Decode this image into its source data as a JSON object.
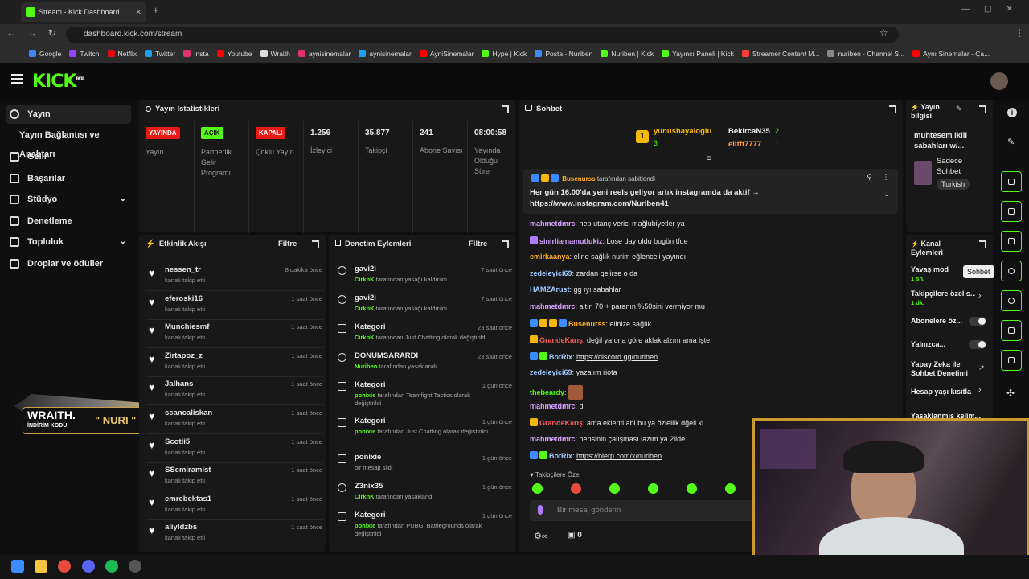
{
  "browser": {
    "tab_title": "Stream - Kick Dashboard",
    "url": "dashboard.kick.com/stream",
    "bookmarks": [
      "Google",
      "Twitch",
      "Netflix",
      "Twitter",
      "Insta",
      "Youtube",
      "Wraith",
      "aynisinemalar",
      "aynisinemalar",
      "AyniSinemalar",
      "Hype | Kick",
      "Posta - Nuriben",
      "Nuriben | Kick",
      "Yayıncı Paneli | Kick",
      "Streamer Content M...",
      "nuriben - Channel S...",
      "Aynı Sinemalar - Ça..."
    ]
  },
  "header": {
    "logo": "KICK",
    "logo_tag": "BETA"
  },
  "sidebar": {
    "items": [
      {
        "label": "Yayın",
        "active": true
      },
      {
        "label": "Yayın Bağlantısı ve Anahtarı"
      },
      {
        "label": "Gelir"
      },
      {
        "label": "Başarılar"
      },
      {
        "label": "Stüdyo"
      },
      {
        "label": "Denetleme"
      },
      {
        "label": "Topluluk"
      },
      {
        "label": "Droplar ve ödüller"
      }
    ]
  },
  "promo": {
    "brand": "WRAITH.",
    "code_label": "İNDİRİM KODU:",
    "code": "\" NURI \""
  },
  "stats": {
    "title": "Yayın İstatistikleri",
    "items": [
      {
        "badge": "YAYINDA",
        "label": "Yayın",
        "color": "#e91916"
      },
      {
        "badge": "AÇIK",
        "label": "Partnerlik Gelir Programı",
        "color": "#53fc18"
      },
      {
        "badge": "KAPALI",
        "label": "Çoklu Yayın",
        "color": "#e91916"
      },
      {
        "value": "1.256",
        "label": "İzleyici"
      },
      {
        "value": "35.877",
        "label": "Takipçi"
      },
      {
        "value": "241",
        "label": "Abone Sayısı"
      },
      {
        "value": "08:00:58",
        "label": "Yayında Olduğu Süre"
      }
    ]
  },
  "activity": {
    "title": "Etkinlik Akışı",
    "filter": "Filtre",
    "items": [
      {
        "name": "nessen_tr",
        "action": "kanalı takip etti",
        "time": "8 dakika önce"
      },
      {
        "name": "eferoski16",
        "action": "kanalı takip etti",
        "time": "1 saat önce"
      },
      {
        "name": "Munchiesmf",
        "action": "kanalı takip etti",
        "time": "1 saat önce"
      },
      {
        "name": "Zirtapoz_z",
        "action": "kanalı takip etti",
        "time": "1 saat önce"
      },
      {
        "name": "Jalhans",
        "action": "kanalı takip etti",
        "time": "1 saat önce"
      },
      {
        "name": "scancaliskan",
        "action": "kanalı takip etti",
        "time": "1 saat önce"
      },
      {
        "name": "Scotii5",
        "action": "kanalı takip etti",
        "time": "1 saat önce"
      },
      {
        "name": "SSemiramist",
        "action": "kanalı takip etti",
        "time": "1 saat önce"
      },
      {
        "name": "emrebektas1",
        "action": "kanalı takip etti",
        "time": "1 saat önce"
      },
      {
        "name": "aliyldzbs",
        "action": "kanalı takip etti",
        "time": "1 saat önce"
      }
    ]
  },
  "moderation": {
    "title": "Denetim Eylemleri",
    "filter": "Filtre",
    "items": [
      {
        "name": "gavi2i",
        "actor": "CirknK",
        "text": "tarafından yasağı kaldırıldı",
        "time": "7 saat önce"
      },
      {
        "name": "gavi2i",
        "actor": "CirknK",
        "text": "tarafından yasağı kaldırıldı",
        "time": "7 saat önce"
      },
      {
        "name": "Kategori",
        "actor": "CirknK",
        "text": "tarafından Just Chatting olarak değiştirildi",
        "time": "23 saat önce"
      },
      {
        "name": "DONUMSARARDI",
        "actor": "Nuriben",
        "text": "tarafından yasaklandı",
        "time": "23 saat önce"
      },
      {
        "name": "Kategori",
        "actor": "ponixie",
        "text": "tarafından Teamfight Tactics olarak değiştirildi",
        "time": "1 gün önce"
      },
      {
        "name": "Kategori",
        "actor": "ponixie",
        "text": "tarafından Just Chatting olarak değiştirildi",
        "time": "1 gün önce"
      },
      {
        "name": "ponixie",
        "actor": "",
        "text": "bir mesajı sildi",
        "time": "1 gün önce"
      },
      {
        "name": "Z3nix35",
        "actor": "CirknK",
        "text": "tarafından yasaklandı",
        "time": "1 gün önce"
      },
      {
        "name": "Kategori",
        "actor": "ponixie",
        "text": "tarafından PUBG: Battlegrounds olarak değiştirildi",
        "time": "1 gün önce"
      }
    ]
  },
  "chat": {
    "title": "Sohbet",
    "top_gifters": [
      {
        "name": "yunushayaloglu",
        "count": "3"
      },
      {
        "name": "BekircaN35",
        "count": "2"
      },
      {
        "name": "elifff7777",
        "count": "1"
      }
    ],
    "pinned": {
      "user": "Busenurss",
      "by": "tarafından sabitlendi",
      "text": "Her gün 16.00'da yeni reels geliyor artık instagramda da aktif →",
      "link": "https://www.instagram.com/Nuriben41"
    },
    "messages": [
      {
        "user": "mahmetdmrc",
        "color": "#d8a3ff",
        "text": "hep utanç verici mağlubiyetler ya"
      },
      {
        "user": "sinirliamamutlukiz",
        "color": "#d8a3ff",
        "text": "Lose day oldu bugün tfde"
      },
      {
        "user": "emirkaanya",
        "color": "#ffb020",
        "text": "eline sağlık nurim eğlenceli yayındı"
      },
      {
        "user": "zedeleyici69",
        "color": "#9ecbff",
        "text": "zardan gelirse o da"
      },
      {
        "user": "HAMZArust",
        "color": "#9ecbff",
        "text": "gg ıyı sabahlar"
      },
      {
        "user": "mahmetdmrc",
        "color": "#d8a3ff",
        "text": "altın 70 + paranın %50sini vermiyor mu"
      },
      {
        "user": "Busenurss",
        "color": "#ffb020",
        "text": "elinize sağlık"
      },
      {
        "user": "GrandeKarış",
        "color": "#ff5a5a",
        "text": "değil ya ona göre aklak alzım ama işte"
      },
      {
        "user": "BotRix",
        "color": "#9ecbff",
        "text": "https://discord.gg/nuriben"
      },
      {
        "user": "zedeleyici69",
        "color": "#9ecbff",
        "text": "yazalım riota"
      },
      {
        "user": "thebeardy",
        "color": "#53fc18",
        "text": ""
      },
      {
        "user": "mahmetdmrc",
        "color": "#d8a3ff",
        "text": "d"
      },
      {
        "user": "GrandeKarış",
        "color": "#ff5a5a",
        "text": "ama eklenti abi bu ya özlellik dğeil ki"
      },
      {
        "user": "mahmetdmrc",
        "color": "#d8a3ff",
        "text": "hepsinin çalışması lazım ya 2lide"
      },
      {
        "user": "BotRix",
        "color": "#9ecbff",
        "text": "https://blerp.com/x/nuriben"
      }
    ],
    "followers_only": "Takipçilere Özel",
    "input_placeholder": "Bir mesaj gönderin",
    "points": "0"
  },
  "stream_info": {
    "title": "Yayın bilgisi",
    "stream_title": "muhtesem ikili sabahları w/...",
    "category": "Sadece Sohbet",
    "language": "Turkish"
  },
  "channel_actions": {
    "title": "Kanal Eylemleri",
    "items": [
      {
        "label": "Yavaş mod",
        "sub": "1 sn."
      },
      {
        "label": "Takipçilere özel s...",
        "sub": "1 dk."
      },
      {
        "label": "Abonelere öz..."
      },
      {
        "label": "Yalnızca..."
      },
      {
        "label": "Yapay Zeka ile Sohbet Denetimi"
      },
      {
        "label": "Hesap yaşı kısıtla"
      },
      {
        "label": "Yasaklanmış kelim..."
      }
    ]
  },
  "tooltip": "Sohbet"
}
